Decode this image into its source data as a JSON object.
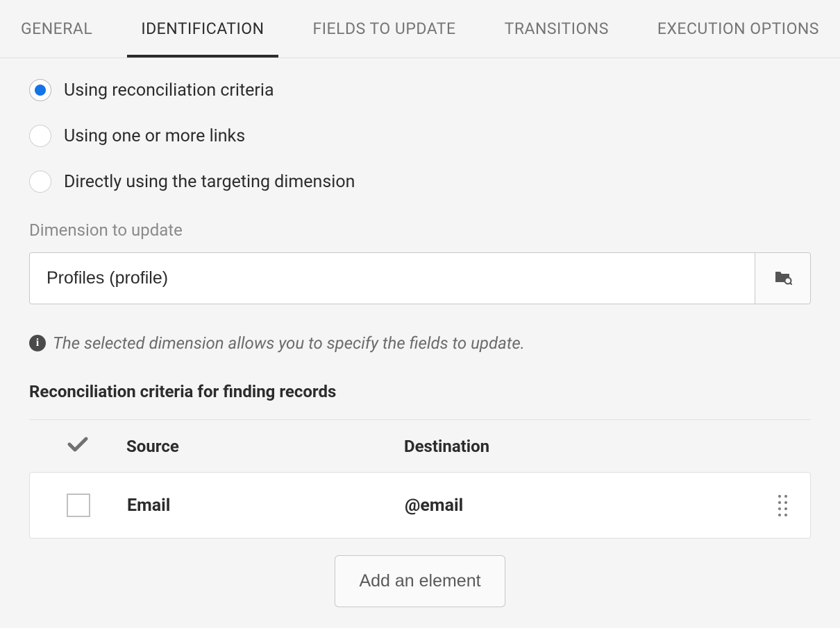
{
  "tabs": {
    "general": "GENERAL",
    "identification": "IDENTIFICATION",
    "fields_to_update": "FIELDS TO UPDATE",
    "transitions": "TRANSITIONS",
    "execution_options": "EXECUTION OPTIONS"
  },
  "radio_options": {
    "reconciliation": "Using reconciliation criteria",
    "links": "Using one or more links",
    "targeting": "Directly using the targeting dimension"
  },
  "dimension": {
    "label": "Dimension to update",
    "value": "Profiles (profile)"
  },
  "info_text": "The selected dimension allows you to specify the fields to update.",
  "section_heading": "Reconciliation criteria for finding records",
  "table": {
    "header_source": "Source",
    "header_destination": "Destination",
    "rows": [
      {
        "source": "Email",
        "destination": "@email"
      }
    ]
  },
  "add_button": "Add an element"
}
